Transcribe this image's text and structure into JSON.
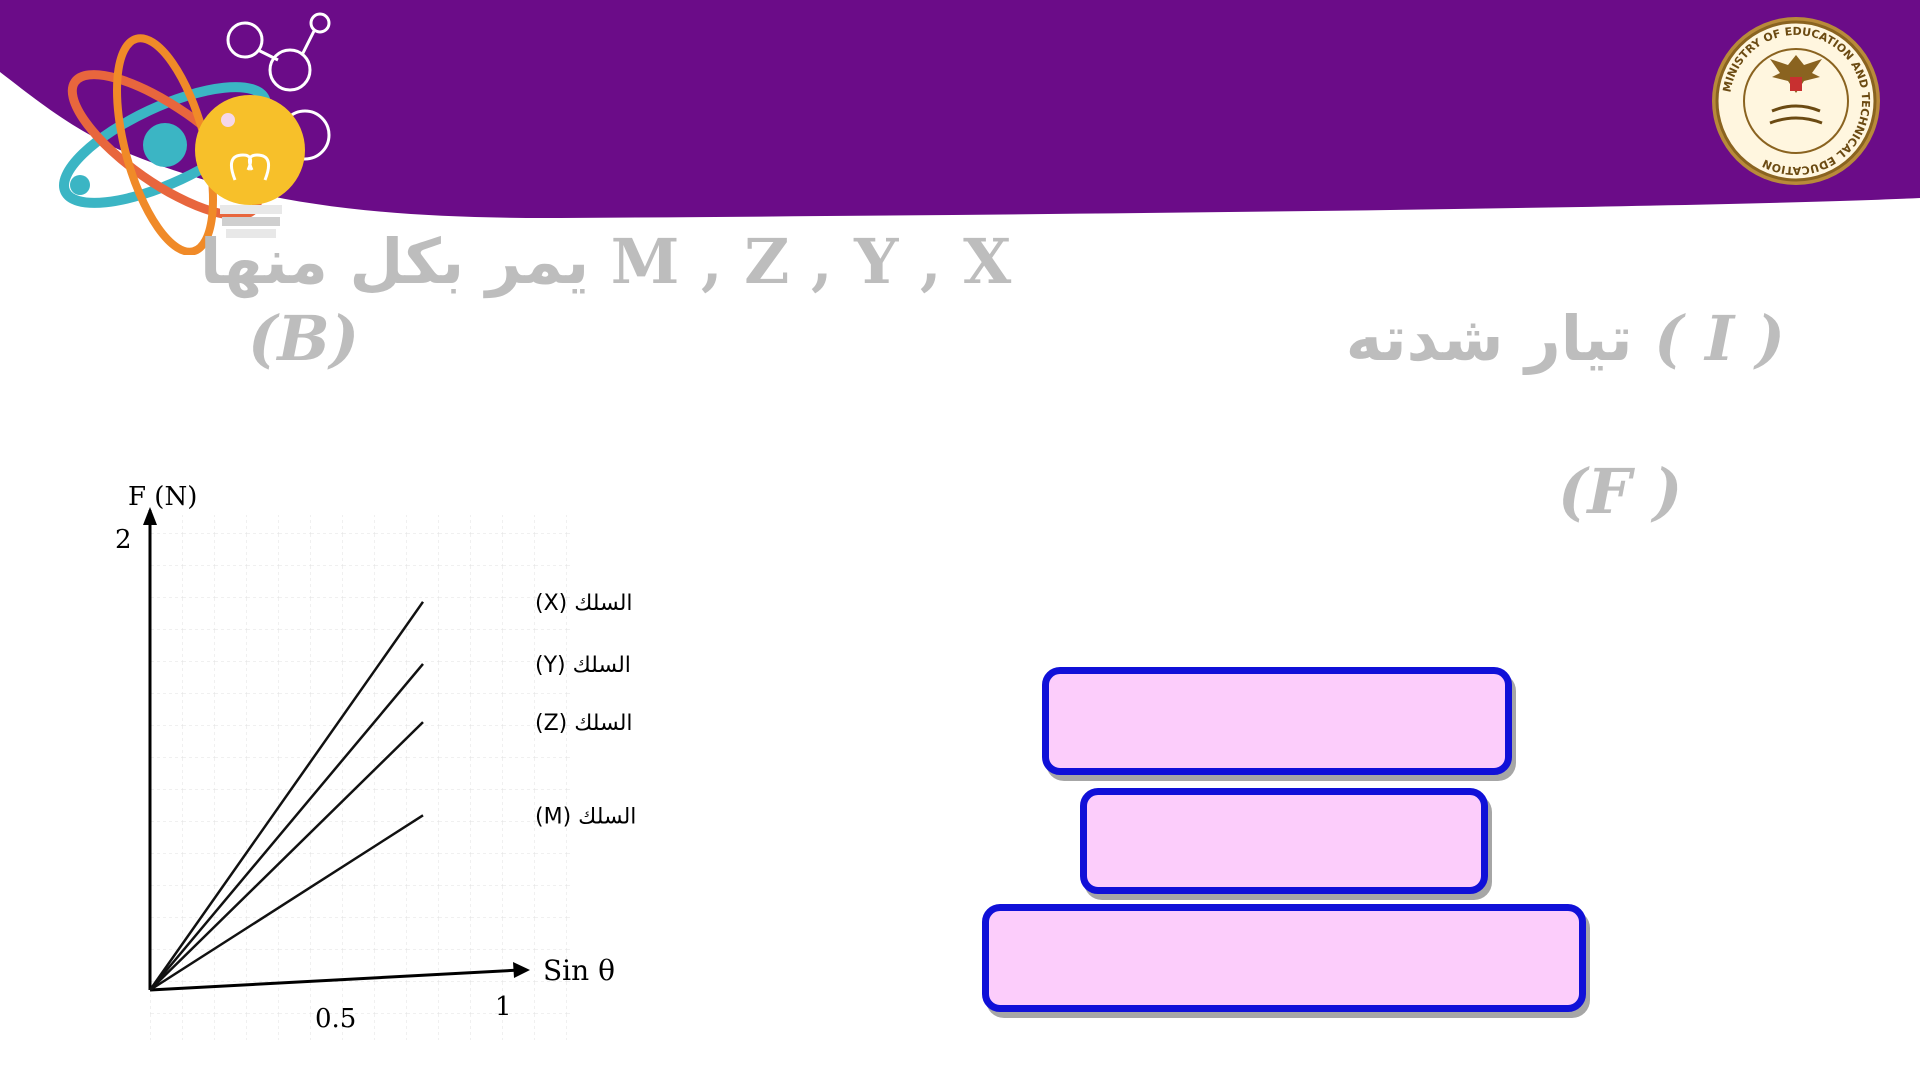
{
  "question": {
    "line1_vars": "M , Z , Y , X",
    "line1_arabic": "يمر بكل منها",
    "field_symbol": "(B)",
    "current_arabic": "تيار شدته",
    "current_symbol": "( I )",
    "force_symbol": "(F )"
  },
  "graph": {
    "y_axis_label": "F (N)",
    "y_tick": "2",
    "x_axis_label": "Sin θ",
    "x_tick_half": "0.5",
    "x_tick_one": "1",
    "wires": [
      {
        "label": "السلك (X)",
        "slope_value": 2.0
      },
      {
        "label": "السلك (Y)",
        "slope_value": 1.68
      },
      {
        "label": "السلك (Z)",
        "slope_value": 1.38
      },
      {
        "label": "السلك (M)",
        "slope_value": 0.9
      }
    ]
  },
  "answer_boxes": [
    "",
    "",
    ""
  ],
  "colors": {
    "banner": "#6b0c88",
    "box_fill": "#fccdfb",
    "box_border": "#1010d8",
    "faded_text": "#bdbdbd"
  },
  "logo": {
    "ministry_name": "MINISTRY OF EDUCATION AND TECHNICAL EDUCATION"
  }
}
